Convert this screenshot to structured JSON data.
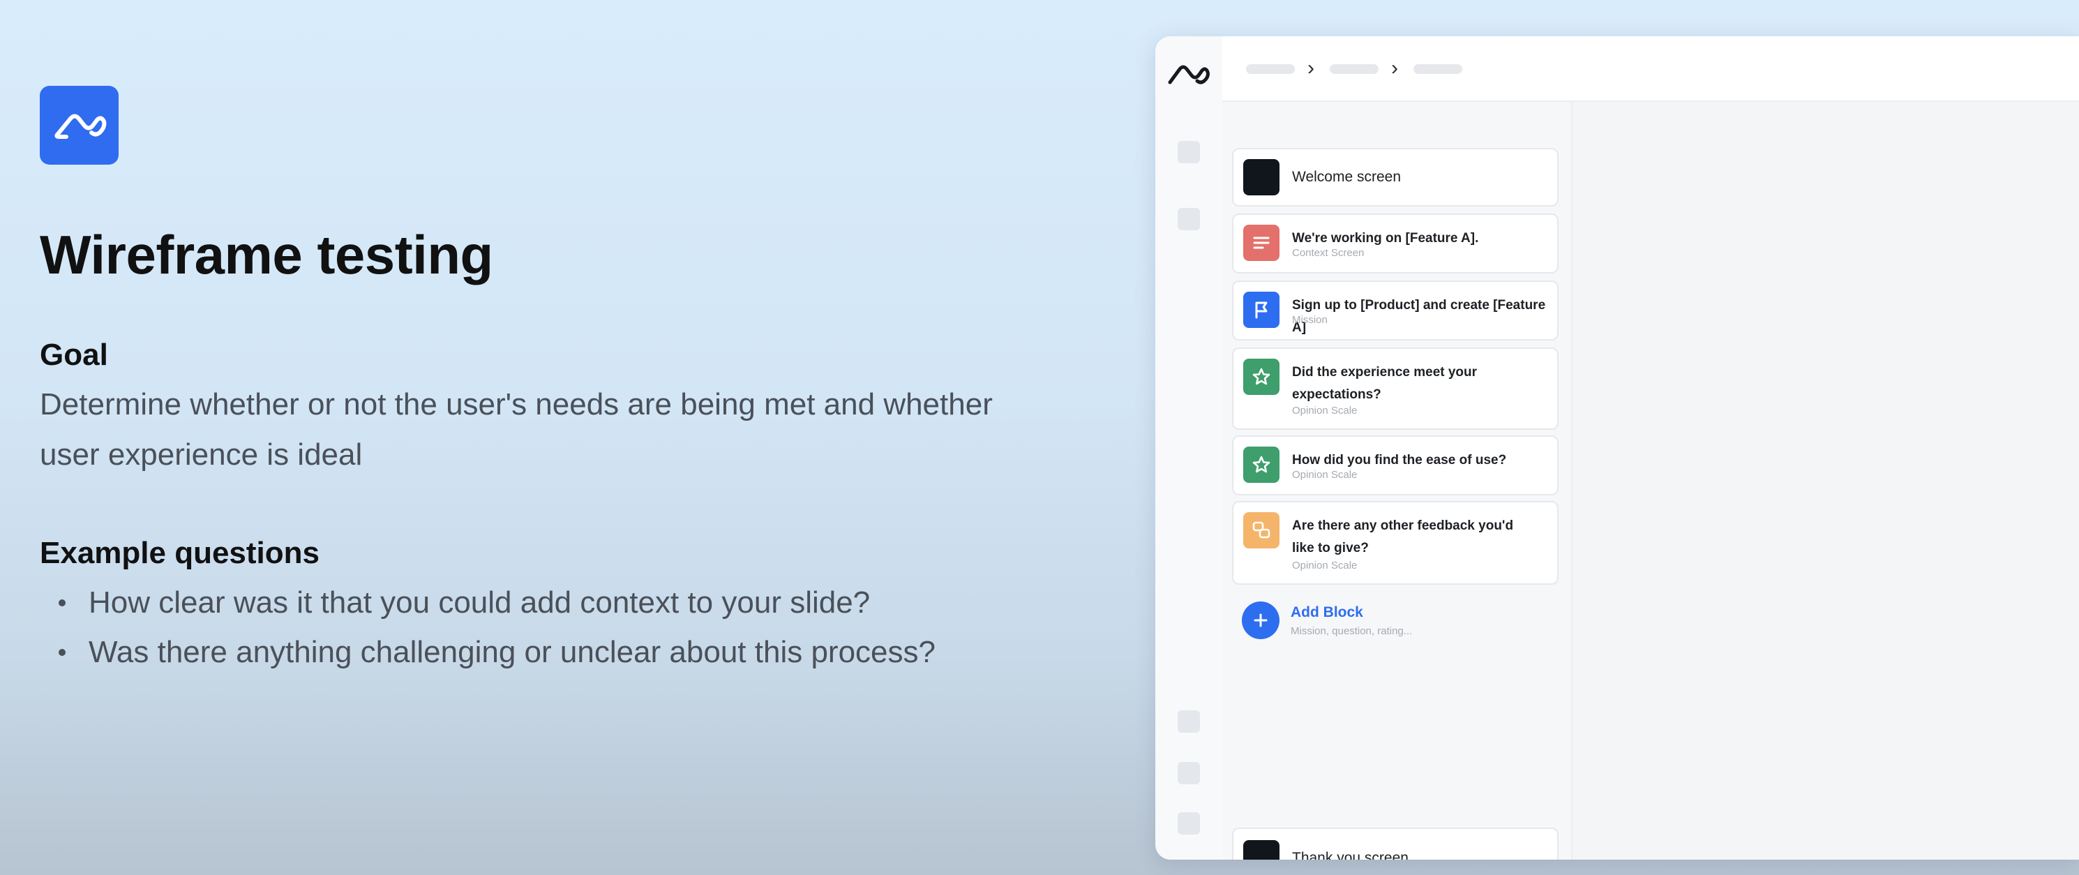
{
  "slide": {
    "title": "Wireframe testing",
    "goal_heading": "Goal",
    "goal_text": "Determine whether or not the user's needs are being met and whether user experience is ideal",
    "questions_heading": "Example questions",
    "questions": [
      "How clear was it that you could add context to your slide?",
      "Was there anything challenging or unclear about this process?"
    ],
    "logo_icon": "maze-logo-icon"
  },
  "app": {
    "rail_logo_icon": "maze-logo-icon",
    "blocks": [
      {
        "title": "Welcome screen",
        "subtitle": "",
        "icon": "welcome-screen-icon",
        "color": "#11151c"
      },
      {
        "title": "We're working on [Feature A].",
        "subtitle": "Context Screen",
        "icon": "text-lines-icon",
        "color": "#e4706b"
      },
      {
        "title": "Sign up to [Product] and create [Feature A]",
        "subtitle": "Mission",
        "icon": "flag-icon",
        "color": "#2d6df0"
      },
      {
        "title": "Did the experience meet your expectations?",
        "subtitle": "Opinion Scale",
        "icon": "star-icon",
        "color": "#3e9e6c"
      },
      {
        "title": "How did you find the ease of use?",
        "subtitle": "Opinion Scale",
        "icon": "star-icon",
        "color": "#3e9e6c"
      },
      {
        "title": "Are there any other feedback you'd like to give?",
        "subtitle": "Opinion Scale",
        "icon": "chat-bubbles-icon",
        "color": "#f4b56a"
      }
    ],
    "add_block": {
      "label": "Add Block",
      "subtitle": "Mission, question, rating..."
    },
    "thank_you": {
      "title": "Thank you screen",
      "icon": "thank-you-screen-icon",
      "color": "#11151c"
    }
  }
}
